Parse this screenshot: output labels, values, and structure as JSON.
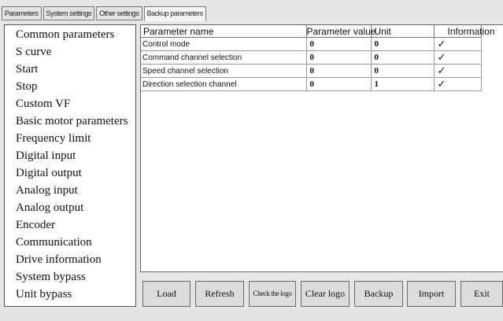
{
  "tabs": [
    "Parameters",
    "System settings",
    "Other settings",
    "Backup parameters"
  ],
  "sidebar": {
    "items": [
      "Common parameters",
      "S curve",
      "Start",
      "Stop",
      "Custom VF",
      "Basic motor parameters",
      "Frequency limit",
      "Digital input",
      "Digital output",
      "Analog input",
      "Analog output",
      "Encoder",
      "Communication",
      "Drive information",
      "System bypass",
      "Unit bypass"
    ]
  },
  "table": {
    "headers": [
      "Parameter name",
      "Parameter value",
      "Unit",
      "Information"
    ],
    "rows": [
      {
        "name": "Control mode",
        "value": "0",
        "unit": "0",
        "info": "✓"
      },
      {
        "name": "Command channel selection",
        "value": "0",
        "unit": "0",
        "info": "✓"
      },
      {
        "name": "Speed channel selection",
        "value": "0",
        "unit": "0",
        "info": "✓"
      },
      {
        "name": "Direction selection channel",
        "value": "0",
        "unit": "1",
        "info": "✓"
      }
    ]
  },
  "buttons": [
    "Load",
    "Refresh",
    "Check the logo",
    "Clear logo",
    "Backup",
    "Import",
    "Exit"
  ]
}
